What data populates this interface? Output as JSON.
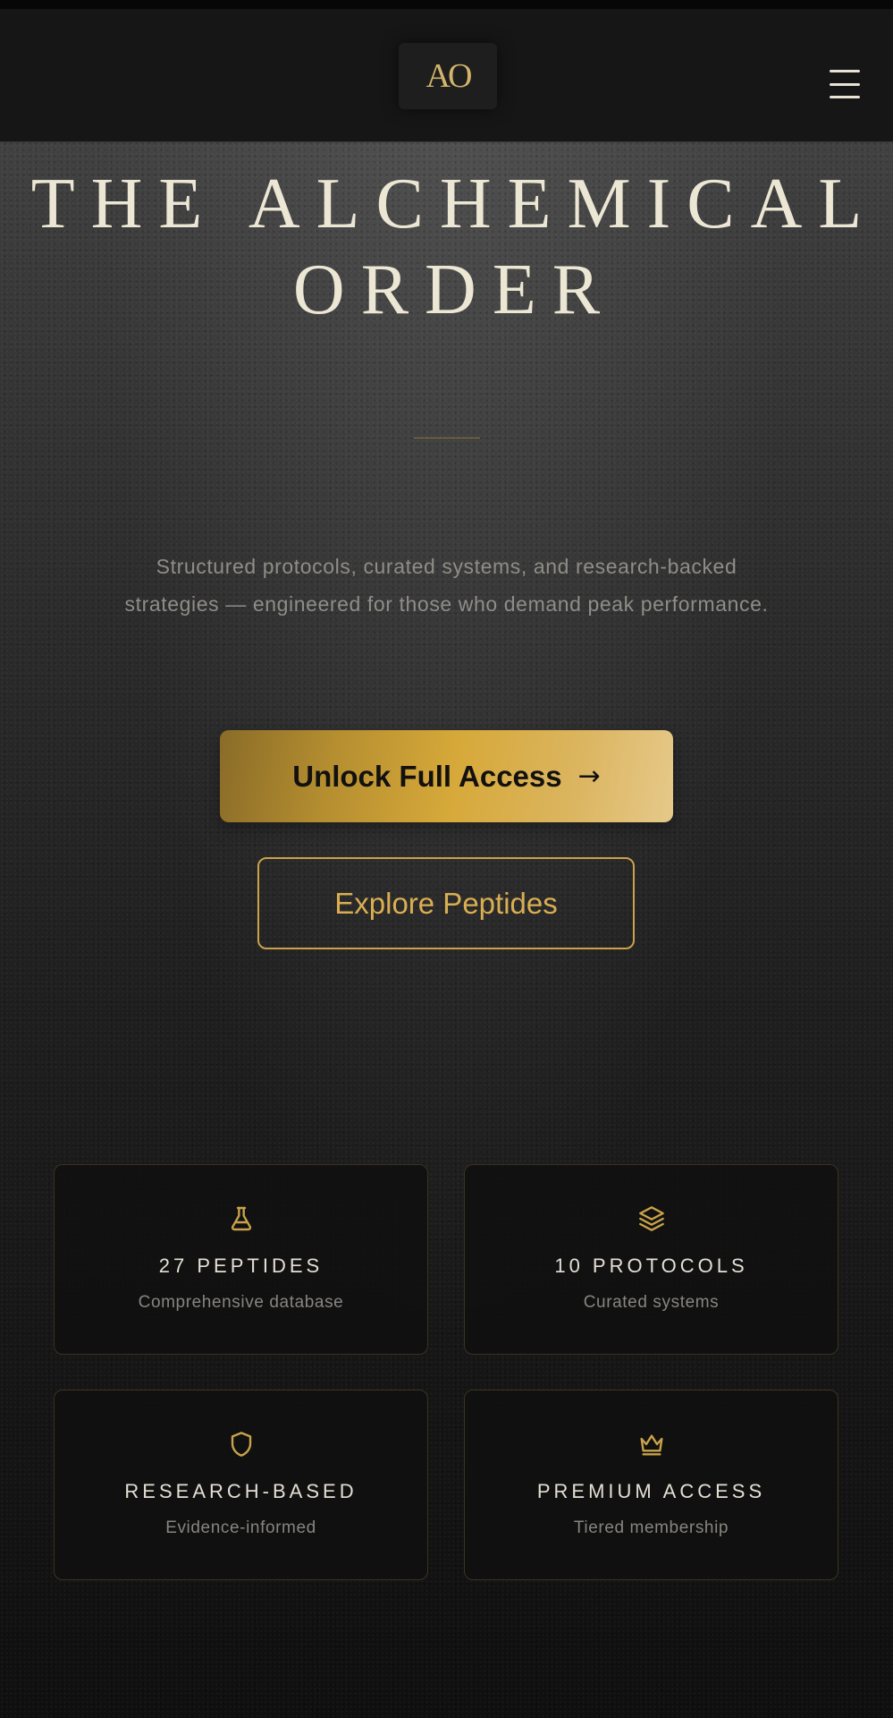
{
  "brand": {
    "logo_text": "AO",
    "accent_color": "#d4a63c"
  },
  "header": {
    "menu_icon": "hamburger-menu-icon"
  },
  "hero": {
    "title_line1": "THE ALCHEMICAL",
    "title_line2": "ORDER",
    "tagline_line1": "Structured protocols, curated systems, and research-backed",
    "tagline_line2": "strategies — engineered for those who demand peak performance."
  },
  "actions": {
    "primary_label": "Unlock Full Access",
    "primary_icon": "arrow-right-icon",
    "secondary_label": "Explore Peptides"
  },
  "features": [
    {
      "icon": "flask-icon",
      "title": "27 PEPTIDES",
      "subtitle": "Comprehensive database"
    },
    {
      "icon": "layers-icon",
      "title": "10 PROTOCOLS",
      "subtitle": "Curated systems"
    },
    {
      "icon": "shield-icon",
      "title": "RESEARCH-BASED",
      "subtitle": "Evidence-informed"
    },
    {
      "icon": "crown-icon",
      "title": "PREMIUM ACCESS",
      "subtitle": "Tiered membership"
    }
  ]
}
